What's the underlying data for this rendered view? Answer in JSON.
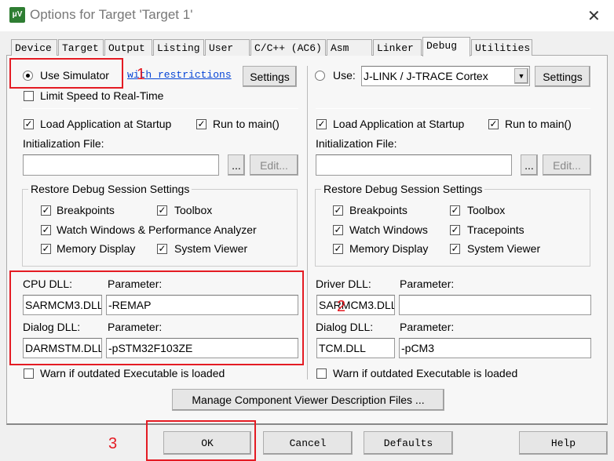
{
  "window": {
    "title": "Options for Target 'Target 1'",
    "icon": "keil-uvision-icon"
  },
  "tabs": [
    "Device",
    "Target",
    "Output",
    "Listing",
    "User",
    "C/C++ (AC6)",
    "Asm",
    "Linker",
    "Debug",
    "Utilities"
  ],
  "selected_tab": "Debug",
  "left": {
    "use_simulator": "Use Simulator",
    "with_restrictions": "with restrictions",
    "settings": "Settings",
    "limit_speed": "Limit Speed to Real-Time",
    "load_app": "Load Application at Startup",
    "run_to_main": "Run to main()",
    "init_file": "Initialization File:",
    "init_value": "",
    "browse": "...",
    "edit": "Edit...",
    "restore_title": "Restore Debug Session Settings",
    "breakpoints": "Breakpoints",
    "toolbox": "Toolbox",
    "watch": "Watch Windows & Performance Analyzer",
    "memory": "Memory Display",
    "sysviewer": "System Viewer",
    "cpu_dll_label": "CPU DLL:",
    "param_label": "Parameter:",
    "cpu_dll": "SARMCM3.DLL",
    "cpu_param": "-REMAP",
    "dialog_dll_label": "Dialog DLL:",
    "dialog_dll": "DARMSTM.DLL",
    "dialog_param": "-pSTM32F103ZE",
    "warn": "Warn if outdated Executable is loaded"
  },
  "right": {
    "use": "Use:",
    "driver": "J-LINK / J-TRACE Cortex",
    "settings": "Settings",
    "load_app": "Load Application at Startup",
    "run_to_main": "Run to main()",
    "init_file": "Initialization File:",
    "init_value": "",
    "browse": "...",
    "edit": "Edit...",
    "restore_title": "Restore Debug Session Settings",
    "breakpoints": "Breakpoints",
    "toolbox": "Toolbox",
    "watch": "Watch Windows",
    "tracepoints": "Tracepoints",
    "memory": "Memory Display",
    "sysviewer": "System Viewer",
    "driver_dll_label": "Driver DLL:",
    "param_label": "Parameter:",
    "driver_dll": "SARMCM3.DLL",
    "driver_param": "",
    "dialog_dll_label": "Dialog DLL:",
    "dialog_dll": "TCM.DLL",
    "dialog_param": "-pCM3",
    "warn": "Warn if outdated Executable is loaded"
  },
  "manage_button": "Manage Component Viewer Description Files ...",
  "buttons": {
    "ok": "OK",
    "cancel": "Cancel",
    "defaults": "Defaults",
    "help": "Help"
  },
  "annotations": {
    "n1": "1",
    "n2": "2",
    "n3": "3",
    "color": "#e41b23"
  }
}
